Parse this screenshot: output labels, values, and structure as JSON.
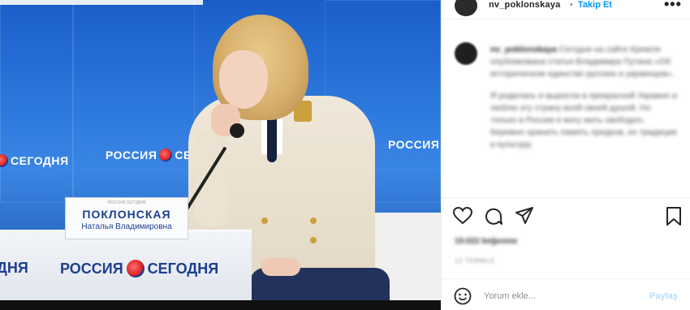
{
  "photo": {
    "logo_text": "РОССИЯ",
    "logo_text2": "СЕГОДНЯ",
    "logo_partial_left": "СЕГОДНЯ",
    "desk_left_partial": "ДНЯ",
    "nameplate": {
      "top_small": "РОССИЯ СЕГОДНЯ",
      "name": "ПОКЛОНСКАЯ",
      "subtitle": "Наталья Владимировна"
    }
  },
  "post_header": {
    "username": "nv_poklonskaya",
    "separator": "•",
    "follow_label": "Takip Et",
    "more_label": "•••"
  },
  "caption": {
    "username": "nv_poklonskaya",
    "paragraph1": "Сегодня на сайте Кремля опубликована статья Владимира Путина «Об историческом единстве русских и украинцев».",
    "paragraph2": "Я родилась и выросла в прекрасной Украине и люблю эту страну всей своей душой. Но только в России я могу жить свободно, бережно хранить память предков, их традиции и культуру."
  },
  "actions": {
    "like_icon": "heart-icon",
    "comment_icon": "comment-icon",
    "share_icon": "share-icon",
    "save_icon": "bookmark-icon"
  },
  "likes_text": "19.022 beğenme",
  "time_text": "12 TEMMUZ",
  "comment_bar": {
    "emoji_icon": "smile-icon",
    "placeholder": "Yorum ekle...",
    "post_label": "Paylaş"
  }
}
